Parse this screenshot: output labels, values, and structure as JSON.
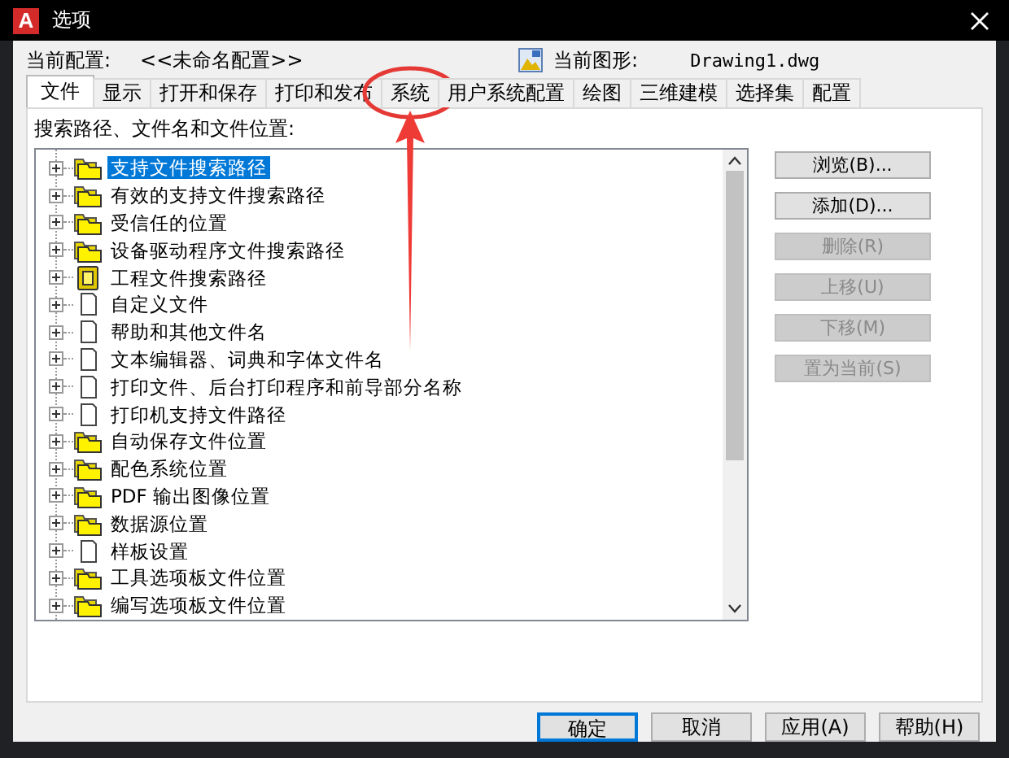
{
  "window": {
    "logo": "A",
    "title": "选项"
  },
  "profile": {
    "label": "当前配置:",
    "value": "<<未命名配置>>"
  },
  "drawing": {
    "label": "当前图形:",
    "value": "Drawing1.dwg"
  },
  "tabs": [
    {
      "label": "文件",
      "selected": true,
      "highlighted": false
    },
    {
      "label": "显示",
      "selected": false,
      "highlighted": false
    },
    {
      "label": "打开和保存",
      "selected": false,
      "highlighted": false
    },
    {
      "label": "打印和发布",
      "selected": false,
      "highlighted": false
    },
    {
      "label": "系统",
      "selected": false,
      "highlighted": true
    },
    {
      "label": "用户系统配置",
      "selected": false,
      "highlighted": false
    },
    {
      "label": "绘图",
      "selected": false,
      "highlighted": false
    },
    {
      "label": "三维建模",
      "selected": false,
      "highlighted": false
    },
    {
      "label": "选择集",
      "selected": false,
      "highlighted": false
    },
    {
      "label": "配置",
      "selected": false,
      "highlighted": false
    }
  ],
  "tree": {
    "label": "搜索路径、文件名和文件位置:",
    "items": [
      {
        "label": "支持文件搜索路径",
        "kind": "folder",
        "selected": true
      },
      {
        "label": "有效的支持文件搜索路径",
        "kind": "folder",
        "selected": false
      },
      {
        "label": "受信任的位置",
        "kind": "folder",
        "selected": false
      },
      {
        "label": "设备驱动程序文件搜索路径",
        "kind": "folder",
        "selected": false
      },
      {
        "label": "工程文件搜索路径",
        "kind": "project",
        "selected": false
      },
      {
        "label": "自定义文件",
        "kind": "file",
        "selected": false
      },
      {
        "label": "帮助和其他文件名",
        "kind": "file",
        "selected": false
      },
      {
        "label": "文本编辑器、词典和字体文件名",
        "kind": "file",
        "selected": false
      },
      {
        "label": "打印文件、后台打印程序和前导部分名称",
        "kind": "file",
        "selected": false
      },
      {
        "label": "打印机支持文件路径",
        "kind": "file",
        "selected": false
      },
      {
        "label": "自动保存文件位置",
        "kind": "folder",
        "selected": false
      },
      {
        "label": "配色系统位置",
        "kind": "folder",
        "selected": false
      },
      {
        "label": "PDF 输出图像位置",
        "kind": "folder",
        "selected": false
      },
      {
        "label": "数据源位置",
        "kind": "folder",
        "selected": false
      },
      {
        "label": "样板设置",
        "kind": "file",
        "selected": false
      },
      {
        "label": "工具选项板文件位置",
        "kind": "folder",
        "selected": false
      },
      {
        "label": "编写选项板文件位置",
        "kind": "folder",
        "selected": false
      }
    ]
  },
  "side_buttons": [
    {
      "label": "浏览(B)...",
      "disabled": false
    },
    {
      "label": "添加(D)...",
      "disabled": false
    },
    {
      "label": "删除(R)",
      "disabled": true
    },
    {
      "label": "上移(U)",
      "disabled": true
    },
    {
      "label": "下移(M)",
      "disabled": true
    },
    {
      "label": "置为当前(S)",
      "disabled": true
    }
  ],
  "buttons": [
    {
      "label": "确定",
      "default": true
    },
    {
      "label": "取消",
      "default": false
    },
    {
      "label": "应用(A)",
      "default": false
    },
    {
      "label": "帮助(H)",
      "default": false
    }
  ]
}
